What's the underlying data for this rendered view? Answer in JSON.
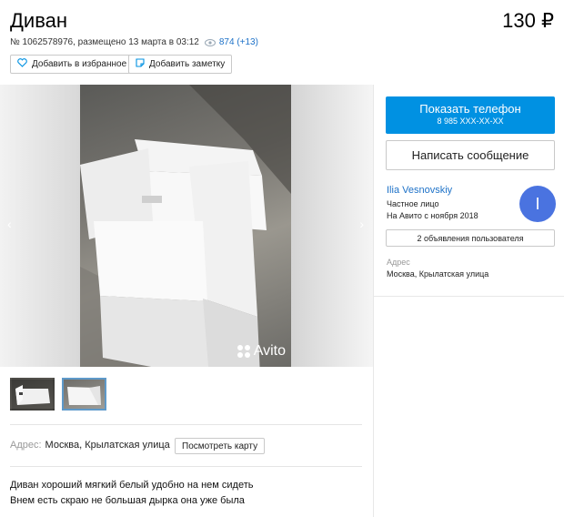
{
  "listing": {
    "title": "Диван",
    "price": "130 ₽",
    "meta": "№ 1062578976, размещено 13 марта в 03:12",
    "views": "874 (+13)"
  },
  "actions": {
    "favorite_label": "Добавить в избранное",
    "note_label": "Добавить заметку"
  },
  "gallery": {
    "watermark": "Avito",
    "prev_arrow": "‹",
    "next_arrow": "›"
  },
  "location": {
    "label": "Адрес:",
    "value": "Москва, Крылатская улица",
    "map_button": "Посмотреть карту"
  },
  "description": {
    "line1": "Диван хороший мягкий белый удобно на нем сидеть",
    "line2": "Внем есть скраю не большая дырка она уже была"
  },
  "contact": {
    "phone_label": "Показать телефон",
    "phone_masked": "8 985 XXX-XX-XX",
    "message_label": "Написать сообщение"
  },
  "seller": {
    "name": "Ilia Vesnovskiy",
    "type": "Частное лицо",
    "since": "На Авито с ноября 2018",
    "avatar_letter": "I",
    "ads_button": "2 объявления пользователя",
    "address_label": "Адрес",
    "address_value": "Москва, Крылатская улица"
  },
  "colors": {
    "primary_button": "#0091e2",
    "link": "#1e72c8",
    "avatar": "#4a73e0"
  },
  "icons": {
    "views": "eye-icon",
    "favorite": "heart-icon",
    "note": "note-icon",
    "watermark": "avito-logo-icon"
  }
}
